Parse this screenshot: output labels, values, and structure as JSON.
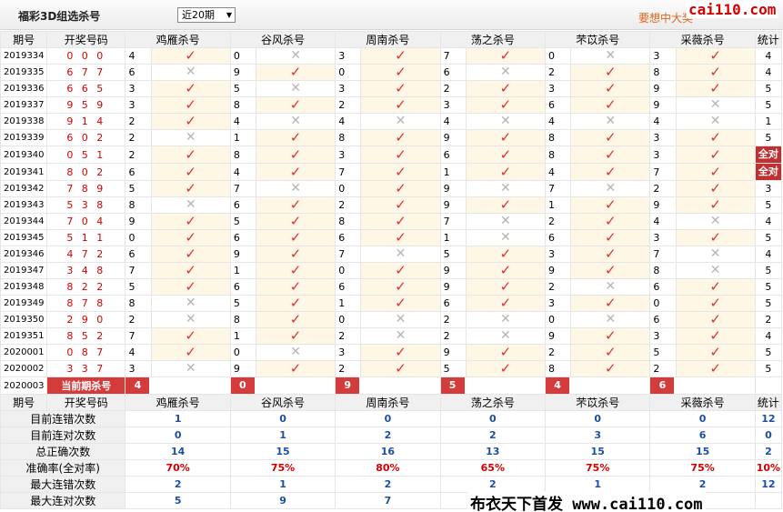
{
  "header": {
    "title": "福彩3D组选杀号",
    "period_select": "近20期",
    "promo": "要想中大奖",
    "watermark_top": "cai110.com"
  },
  "columns": [
    "期号",
    "开奖号码",
    "鸡雁杀号",
    "谷风杀号",
    "周南杀号",
    "荡之杀号",
    "芣苡杀号",
    "采薇杀号",
    "统计"
  ],
  "experts": [
    "鸡雁杀号",
    "谷风杀号",
    "周南杀号",
    "荡之杀号",
    "芣苡杀号",
    "采薇杀号"
  ],
  "rows": [
    {
      "period": "2019334",
      "win": "0 0 0",
      "k": [
        [
          4,
          1
        ],
        [
          0,
          0
        ],
        [
          3,
          1
        ],
        [
          7,
          1
        ],
        [
          0,
          0
        ],
        [
          3,
          1
        ]
      ],
      "sum": "4"
    },
    {
      "period": "2019335",
      "win": "6 7 7",
      "k": [
        [
          6,
          0
        ],
        [
          9,
          1
        ],
        [
          0,
          1
        ],
        [
          6,
          0
        ],
        [
          2,
          1
        ],
        [
          8,
          1
        ]
      ],
      "sum": "4"
    },
    {
      "period": "2019336",
      "win": "6 6 5",
      "k": [
        [
          3,
          1
        ],
        [
          5,
          0
        ],
        [
          3,
          1
        ],
        [
          2,
          1
        ],
        [
          3,
          1
        ],
        [
          9,
          1
        ]
      ],
      "sum": "5"
    },
    {
      "period": "2019337",
      "win": "9 5 9",
      "k": [
        [
          3,
          1
        ],
        [
          8,
          1
        ],
        [
          2,
          1
        ],
        [
          3,
          1
        ],
        [
          6,
          1
        ],
        [
          9,
          0
        ]
      ],
      "sum": "5"
    },
    {
      "period": "2019338",
      "win": "9 1 4",
      "k": [
        [
          2,
          1
        ],
        [
          4,
          0
        ],
        [
          4,
          0
        ],
        [
          4,
          0
        ],
        [
          4,
          0
        ],
        [
          4,
          0
        ]
      ],
      "sum": "1"
    },
    {
      "period": "2019339",
      "win": "6 0 2",
      "k": [
        [
          2,
          0
        ],
        [
          1,
          1
        ],
        [
          8,
          1
        ],
        [
          9,
          1
        ],
        [
          8,
          1
        ],
        [
          3,
          1
        ]
      ],
      "sum": "5"
    },
    {
      "period": "2019340",
      "win": "0 5 1",
      "k": [
        [
          2,
          1
        ],
        [
          8,
          1
        ],
        [
          3,
          1
        ],
        [
          6,
          1
        ],
        [
          8,
          1
        ],
        [
          3,
          1
        ]
      ],
      "sum": "全对"
    },
    {
      "period": "2019341",
      "win": "8 0 2",
      "k": [
        [
          6,
          1
        ],
        [
          4,
          1
        ],
        [
          7,
          1
        ],
        [
          1,
          1
        ],
        [
          4,
          1
        ],
        [
          7,
          1
        ]
      ],
      "sum": "全对"
    },
    {
      "period": "2019342",
      "win": "7 8 9",
      "k": [
        [
          5,
          1
        ],
        [
          7,
          0
        ],
        [
          0,
          1
        ],
        [
          9,
          0
        ],
        [
          7,
          0
        ],
        [
          2,
          1
        ]
      ],
      "sum": "3"
    },
    {
      "period": "2019343",
      "win": "5 3 8",
      "k": [
        [
          8,
          0
        ],
        [
          6,
          1
        ],
        [
          2,
          1
        ],
        [
          9,
          1
        ],
        [
          1,
          1
        ],
        [
          9,
          1
        ]
      ],
      "sum": "5"
    },
    {
      "period": "2019344",
      "win": "7 0 4",
      "k": [
        [
          9,
          1
        ],
        [
          5,
          1
        ],
        [
          8,
          1
        ],
        [
          7,
          0
        ],
        [
          2,
          1
        ],
        [
          4,
          0
        ]
      ],
      "sum": "4"
    },
    {
      "period": "2019345",
      "win": "5 1 1",
      "k": [
        [
          0,
          1
        ],
        [
          6,
          1
        ],
        [
          6,
          1
        ],
        [
          1,
          0
        ],
        [
          6,
          1
        ],
        [
          3,
          1
        ]
      ],
      "sum": "5"
    },
    {
      "period": "2019346",
      "win": "4 7 2",
      "k": [
        [
          6,
          1
        ],
        [
          9,
          1
        ],
        [
          7,
          0
        ],
        [
          5,
          1
        ],
        [
          3,
          1
        ],
        [
          7,
          0
        ]
      ],
      "sum": "4"
    },
    {
      "period": "2019347",
      "win": "3 4 8",
      "k": [
        [
          7,
          1
        ],
        [
          1,
          1
        ],
        [
          0,
          1
        ],
        [
          9,
          1
        ],
        [
          9,
          1
        ],
        [
          8,
          0
        ]
      ],
      "sum": "5"
    },
    {
      "period": "2019348",
      "win": "8 2 2",
      "k": [
        [
          5,
          1
        ],
        [
          6,
          1
        ],
        [
          6,
          1
        ],
        [
          9,
          1
        ],
        [
          2,
          0
        ],
        [
          6,
          1
        ]
      ],
      "sum": "5"
    },
    {
      "period": "2019349",
      "win": "8 7 8",
      "k": [
        [
          8,
          0
        ],
        [
          5,
          1
        ],
        [
          1,
          1
        ],
        [
          6,
          1
        ],
        [
          3,
          1
        ],
        [
          0,
          1
        ]
      ],
      "sum": "5"
    },
    {
      "period": "2019350",
      "win": "2 9 0",
      "k": [
        [
          2,
          0
        ],
        [
          8,
          1
        ],
        [
          0,
          0
        ],
        [
          2,
          0
        ],
        [
          0,
          0
        ],
        [
          6,
          1
        ]
      ],
      "sum": "2"
    },
    {
      "period": "2019351",
      "win": "8 5 2",
      "k": [
        [
          7,
          1
        ],
        [
          1,
          1
        ],
        [
          2,
          0
        ],
        [
          2,
          0
        ],
        [
          9,
          1
        ],
        [
          3,
          1
        ]
      ],
      "sum": "4"
    },
    {
      "period": "2020001",
      "win": "0 8 7",
      "k": [
        [
          4,
          1
        ],
        [
          0,
          0
        ],
        [
          3,
          1
        ],
        [
          9,
          1
        ],
        [
          2,
          1
        ],
        [
          5,
          1
        ]
      ],
      "sum": "5"
    },
    {
      "period": "2020002",
      "win": "3 3 7",
      "k": [
        [
          3,
          0
        ],
        [
          9,
          1
        ],
        [
          2,
          1
        ],
        [
          5,
          1
        ],
        [
          8,
          1
        ],
        [
          2,
          1
        ]
      ],
      "sum": "5"
    }
  ],
  "current": {
    "period": "2020003",
    "label": "当前期杀号",
    "nums": [
      "4",
      "0",
      "9",
      "5",
      "4",
      "6"
    ]
  },
  "stats": [
    {
      "label": "目前连错次数",
      "vals": [
        "1",
        "0",
        "0",
        "0",
        "0",
        "0"
      ],
      "total": "12"
    },
    {
      "label": "目前连对次数",
      "vals": [
        "0",
        "1",
        "2",
        "2",
        "3",
        "6"
      ],
      "total": "0"
    },
    {
      "label": "总正确次数",
      "vals": [
        "14",
        "15",
        "16",
        "13",
        "15",
        "15"
      ],
      "total": "2"
    },
    {
      "label": "准确率(全对率)",
      "vals": [
        "70%",
        "75%",
        "80%",
        "65%",
        "75%",
        "75%"
      ],
      "total": "10%"
    },
    {
      "label": "最大连错次数",
      "vals": [
        "2",
        "1",
        "2",
        "2",
        "1",
        "2"
      ],
      "total": "12"
    },
    {
      "label": "最大连对次数",
      "vals": [
        "5",
        "9",
        "7",
        "",
        "",
        ""
      ],
      "total": ""
    }
  ],
  "watermark_bottom": "布衣天下首发 www.cai110.com",
  "icons": {
    "ok": "check-icon",
    "bad": "cross-icon"
  },
  "colors": {
    "check": "#e03030",
    "cross": "#b5b5b5",
    "accent": "#d43c3c",
    "stat": "#1f4fa0"
  }
}
